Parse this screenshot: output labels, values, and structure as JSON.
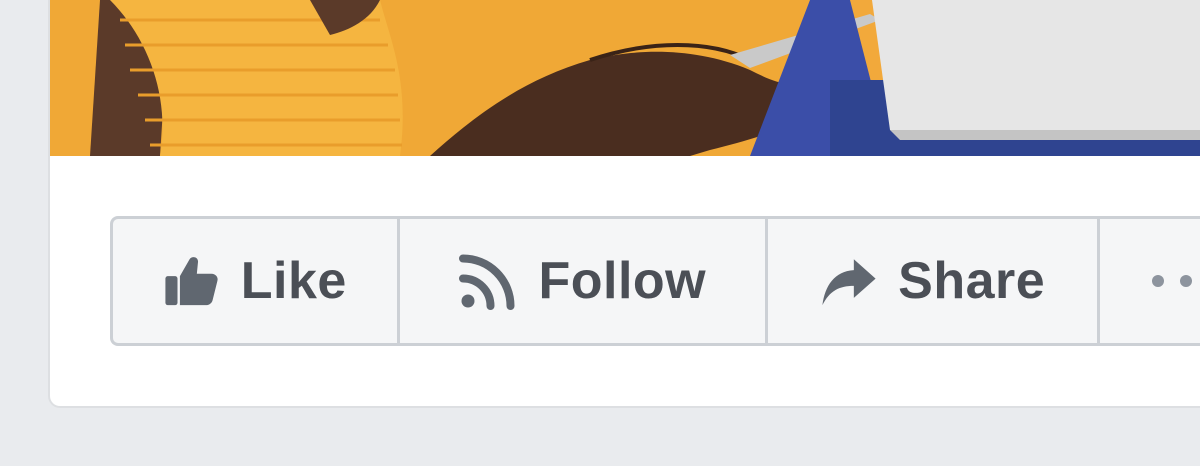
{
  "cover": {
    "description_icon": "cover-photo",
    "colors": {
      "background": "#f2a93b",
      "accent_blue": "#3b4ea8",
      "laptop": "#e6e6e6"
    }
  },
  "actions": {
    "like": {
      "label": "Like",
      "icon": "thumbs-up-icon"
    },
    "follow": {
      "label": "Follow",
      "icon": "rss-icon"
    },
    "share": {
      "label": "Share",
      "icon": "share-arrow-icon"
    },
    "more": {
      "icon": "more-dots-icon"
    }
  },
  "colors": {
    "page_bg": "#e9ebee",
    "card_bg": "#ffffff",
    "button_bg": "#f5f6f7",
    "button_border": "#ccd0d5",
    "text": "#4b4f56",
    "icon": "#606770"
  }
}
